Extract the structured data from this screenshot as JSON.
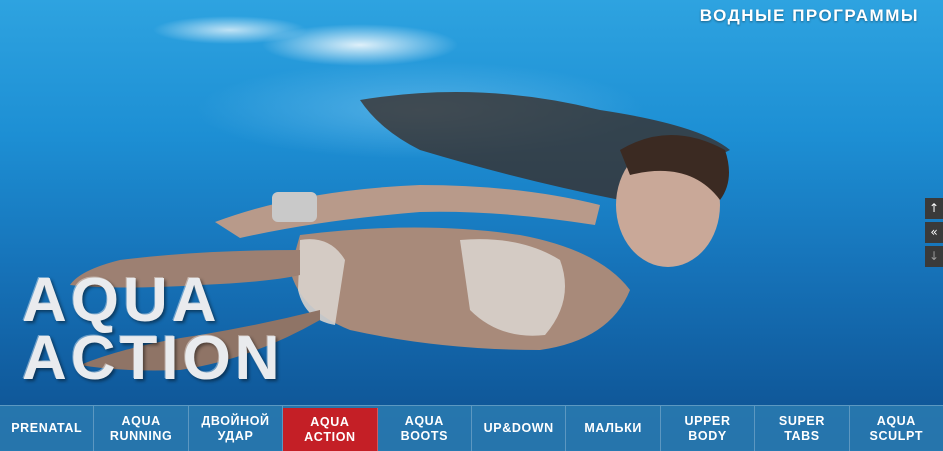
{
  "header": {
    "program_title": "ВОДНЫЕ ПРОГРАММЫ"
  },
  "hero": {
    "heading_line1": "AQUA",
    "heading_line2": "ACTION"
  },
  "side_controls": {
    "up_icon": "arrow-up-icon",
    "collapse_icon": "double-chevron-left-icon",
    "down_icon": "arrow-down-icon"
  },
  "nav": {
    "items": [
      {
        "line1": "PRENATAL",
        "line2": ""
      },
      {
        "line1": "AQUA",
        "line2": "RUNNING"
      },
      {
        "line1": "ДВОЙНОЙ",
        "line2": "УДАР"
      },
      {
        "line1": "AQUA",
        "line2": "ACTION",
        "active": true
      },
      {
        "line1": "AQUA",
        "line2": "BOOTS"
      },
      {
        "line1": "UP&DOWN",
        "line2": ""
      },
      {
        "line1": "МАЛЬКИ",
        "line2": ""
      },
      {
        "line1": "UPPER BODY",
        "line2": ""
      },
      {
        "line1": "SUPER TABS",
        "line2": ""
      },
      {
        "line1": "AQUA",
        "line2": "SCULPT"
      }
    ]
  },
  "colors": {
    "active_tab": "#c41f26",
    "nav_bg": "#2878af",
    "water": "#1d8fd4"
  }
}
